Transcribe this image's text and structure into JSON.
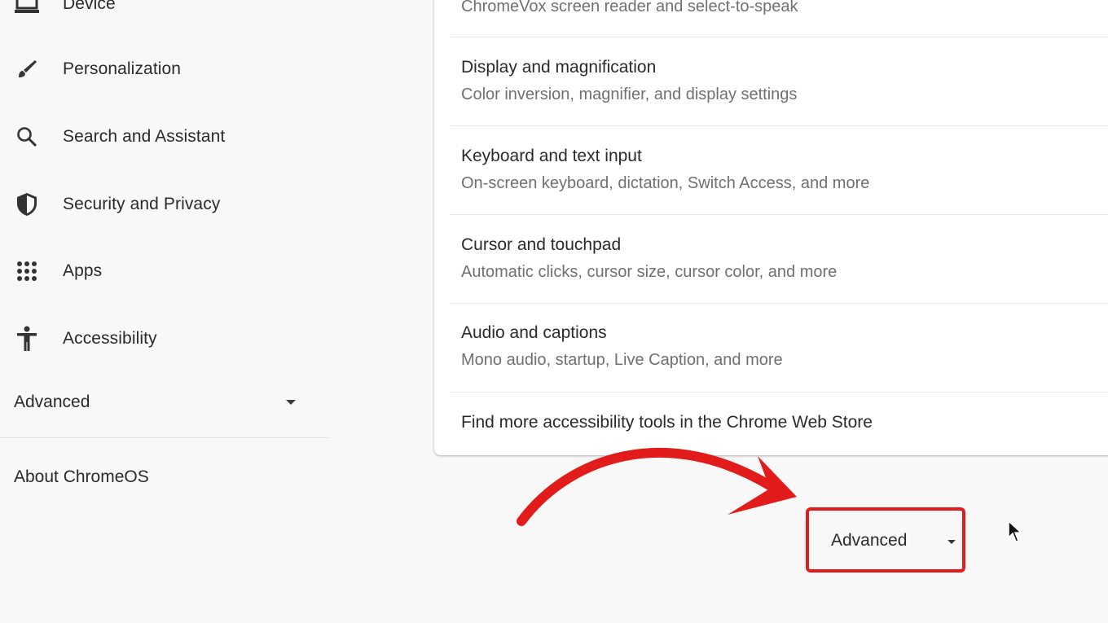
{
  "sidebar": {
    "items": [
      {
        "label": "Device",
        "icon": "laptop-icon"
      },
      {
        "label": "Personalization",
        "icon": "brush-icon"
      },
      {
        "label": "Search and Assistant",
        "icon": "search-icon"
      },
      {
        "label": "Security and Privacy",
        "icon": "shield-icon"
      },
      {
        "label": "Apps",
        "icon": "apps-grid-icon"
      },
      {
        "label": "Accessibility",
        "icon": "accessibility-icon"
      }
    ],
    "advanced_label": "Advanced",
    "about_label": "About ChromeOS"
  },
  "accessibility_card": {
    "rows": [
      {
        "title": "",
        "subtitle": "ChromeVox screen reader and select-to-speak"
      },
      {
        "title": "Display and magnification",
        "subtitle": "Color inversion, magnifier, and display settings"
      },
      {
        "title": "Keyboard and text input",
        "subtitle": "On-screen keyboard, dictation, Switch Access, and more"
      },
      {
        "title": "Cursor and touchpad",
        "subtitle": "Automatic clicks, cursor size, cursor color, and more"
      },
      {
        "title": "Audio and captions",
        "subtitle": "Mono audio, startup, Live Caption, and more"
      }
    ],
    "web_store_link": "Find more accessibility tools in the Chrome Web Store"
  },
  "main_advanced_label": "Advanced",
  "annotation": {
    "color": "#e21b1b"
  }
}
